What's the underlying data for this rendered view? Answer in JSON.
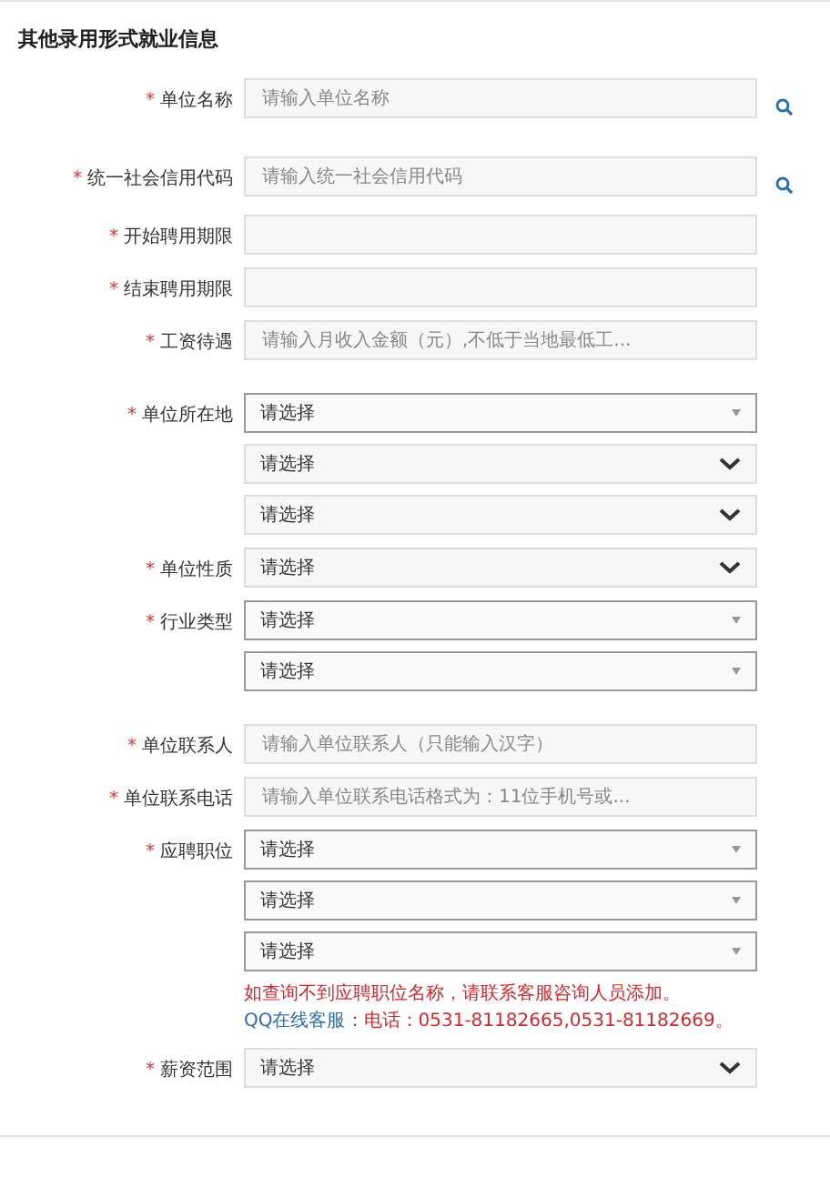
{
  "title": "其他录用形式就业信息",
  "groups": [
    {
      "rows": [
        {
          "mark": "*",
          "label": "单位名称",
          "search": true,
          "controls": [
            {
              "kind": "text",
              "placeholder": "请输入单位名称"
            }
          ]
        }
      ]
    },
    {
      "rows": [
        {
          "mark": "*",
          "label": "统一社会信用代码",
          "search": true,
          "controls": [
            {
              "kind": "text",
              "placeholder": "请输入统一社会信用代码"
            }
          ]
        },
        {
          "mark": "*",
          "label": "开始聘用期限",
          "search": false,
          "controls": [
            {
              "kind": "text"
            }
          ]
        },
        {
          "mark": "*",
          "label": "结束聘用期限",
          "search": false,
          "controls": [
            {
              "kind": "text"
            }
          ]
        },
        {
          "mark": "*",
          "label": "工资待遇",
          "search": false,
          "controls": [
            {
              "kind": "text",
              "placeholder": "请输入月收入金额（元）,不低于当地最低工..."
            }
          ]
        }
      ]
    },
    {
      "rows": [
        {
          "mark": "*",
          "label": "单位所在地",
          "search": false,
          "controls": [
            {
              "kind": "dropdown",
              "value": "请选择"
            },
            {
              "kind": "select",
              "value": "请选择"
            },
            {
              "kind": "select",
              "value": "请选择"
            }
          ]
        },
        {
          "mark": "*",
          "label": "单位性质",
          "search": false,
          "controls": [
            {
              "kind": "select",
              "value": "请选择"
            }
          ]
        },
        {
          "mark": "*",
          "label": "行业类型",
          "search": false,
          "controls": [
            {
              "kind": "dropdown",
              "value": "请选择"
            },
            {
              "kind": "dropdown",
              "value": "请选择"
            }
          ]
        }
      ]
    },
    {
      "rows": [
        {
          "mark": "*",
          "label": "单位联系人",
          "search": false,
          "controls": [
            {
              "kind": "text",
              "placeholder": "请输入单位联系人（只能输入汉字）"
            }
          ]
        },
        {
          "mark": "*",
          "label": "单位联系电话",
          "search": false,
          "controls": [
            {
              "kind": "text",
              "placeholder": "请输入单位联系电话格式为：11位手机号或..."
            }
          ]
        },
        {
          "mark": "*",
          "label": "应聘职位",
          "search": false,
          "controls": [
            {
              "kind": "dropdown",
              "value": "请选择"
            },
            {
              "kind": "dropdown",
              "value": "请选择"
            },
            {
              "kind": "dropdown",
              "value": "请选择"
            }
          ],
          "note": [
            [
              {
                "kind": "warning",
                "text": "如查询不到应聘职位名称，请联系客服咨询人员添加。"
              }
            ],
            [
              {
                "kind": "link",
                "text": "QQ在线客服"
              },
              {
                "kind": "warning",
                "text": "：电话：0531-81182665,0531-81182669。"
              }
            ]
          ]
        },
        {
          "mark": "*",
          "label": "薪资范围",
          "search": false,
          "controls": [
            {
              "kind": "select",
              "value": "请选择"
            }
          ]
        }
      ]
    }
  ]
}
